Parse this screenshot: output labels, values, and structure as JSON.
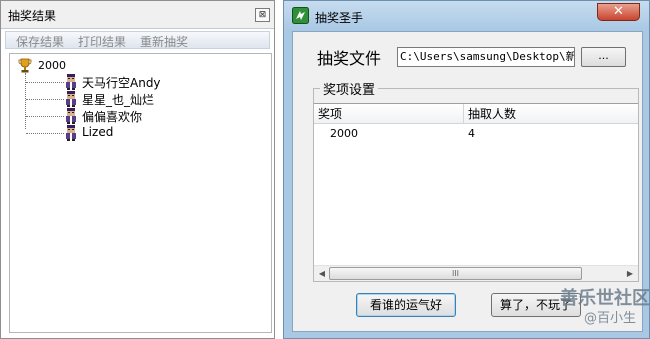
{
  "left_window": {
    "title": "抽奖结果",
    "close_glyph": "⊠",
    "menu": [
      "保存结果",
      "打印结果",
      "重新抽奖"
    ],
    "tree": {
      "root_label": "2000",
      "root_icon": "trophy-icon",
      "children": [
        "天马行空Andy",
        "星星_也_灿烂",
        "偏偏喜欢你",
        "Lized"
      ],
      "child_icon": "user-icon"
    }
  },
  "right_window": {
    "title": "抽奖圣手",
    "app_icon": "lottery-app-icon",
    "close_glyph": "✕",
    "file_label": "抽奖文件",
    "file_path": "C:\\Users\\samsung\\Desktop\\新建",
    "browse_label": "...",
    "group_label": "奖项设置",
    "table": {
      "columns": [
        "奖项",
        "抽取人数"
      ],
      "rows": [
        [
          "2000",
          "4"
        ]
      ]
    },
    "scroll_left": "◀",
    "scroll_thumb": "III",
    "scroll_right": "▶",
    "draw_button": "看谁的运气好",
    "quit_button": "算了，不玩了"
  },
  "watermark": {
    "main": "善乐世社区",
    "sub": "@百小生"
  },
  "colors": {
    "window_frame": "#a9c8e4",
    "client_bg": "#f0f0f0",
    "close_red": "#c9452f"
  }
}
